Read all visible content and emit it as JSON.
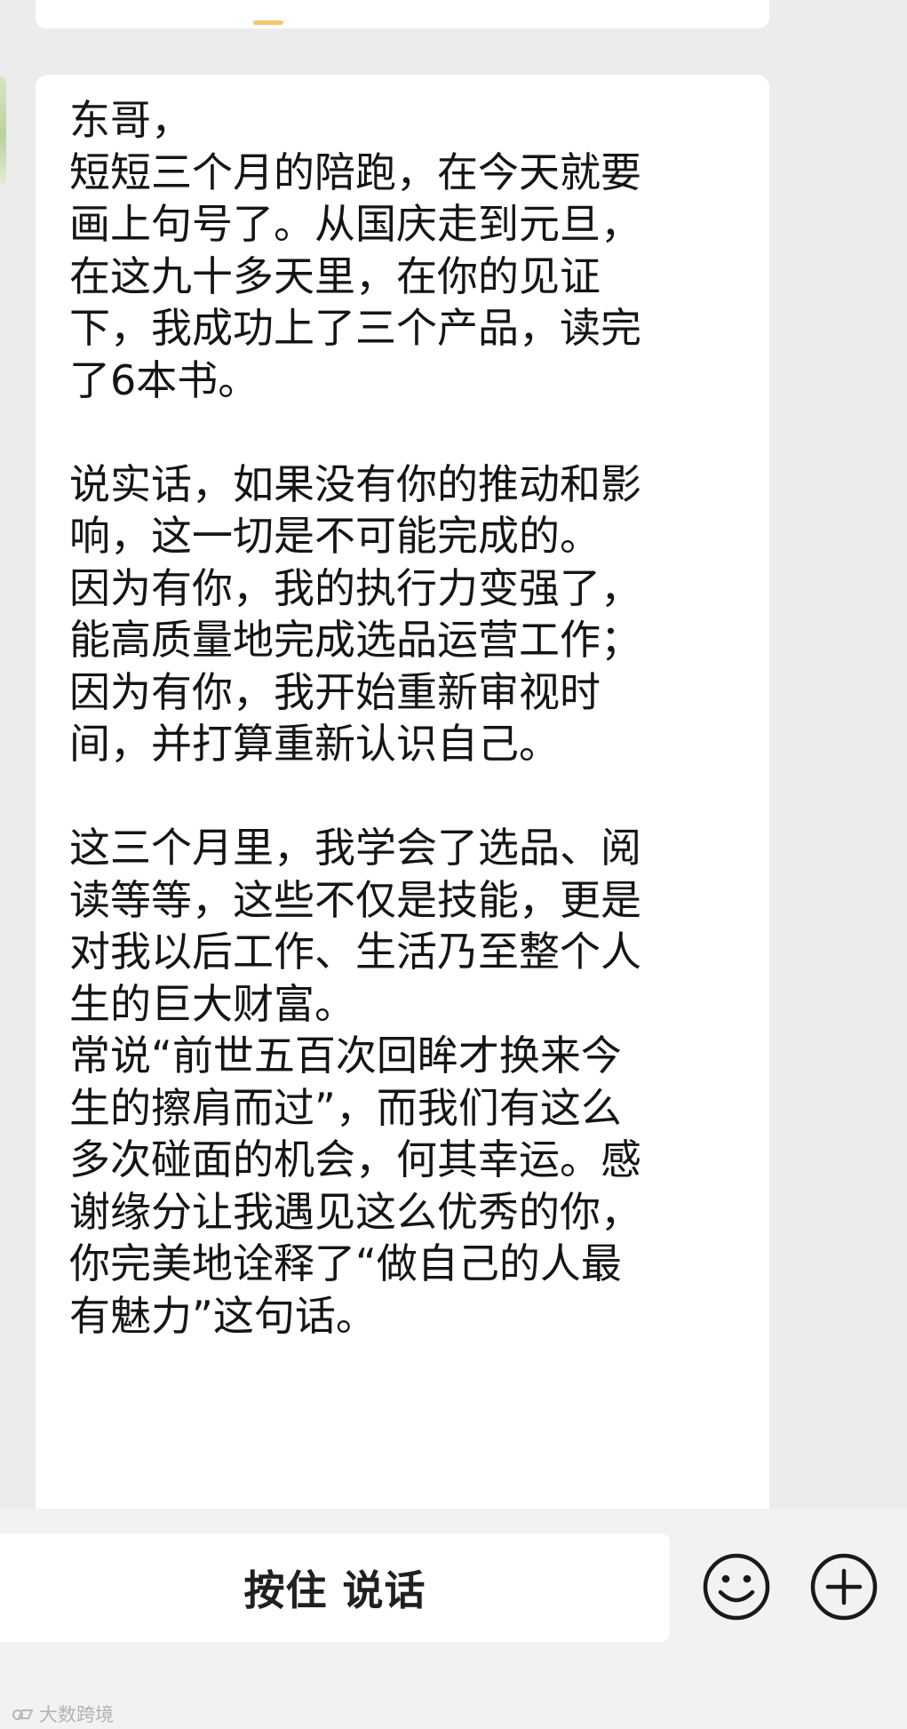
{
  "conversation": {
    "message": {
      "lines": [
        "东哥，",
        "短短三个月的陪跑，在今天就要",
        "画上句号了。从国庆走到元旦，",
        "在这九十多天里，在你的见证",
        "下，我成功上了三个产品，读完",
        "了6本书。",
        "",
        "说实话，如果没有你的推动和影",
        "响，这一切是不可能完成的。",
        "因为有你，我的执行力变强了，",
        "能高质量地完成选品运营工作；",
        "因为有你，我开始重新审视时",
        "间，并打算重新认识自己。",
        "",
        "这三个月里，我学会了选品、阅",
        "读等等，这些不仅是技能，更是",
        "对我以后工作、生活乃至整个人",
        "生的巨大财富。",
        "常说“前世五百次回眸才换来今",
        "生的擦肩而过”，而我们有这么",
        "多次碰面的机会，何其幸运。感",
        "谢缘分让我遇见这么优秀的你，",
        "你完美地诠释了“做自己的人最",
        "有魅力”这句话。"
      ]
    }
  },
  "input_bar": {
    "voice_button_label": "按住 说话",
    "emoji_icon": "emoji-icon",
    "add_icon": "plus-circle-icon"
  },
  "watermark": {
    "text": "大数跨境"
  },
  "colors": {
    "chat_background": "#ececec",
    "bubble": "#ffffff",
    "text": "#151515",
    "input_bar": "#f2f2f2"
  }
}
